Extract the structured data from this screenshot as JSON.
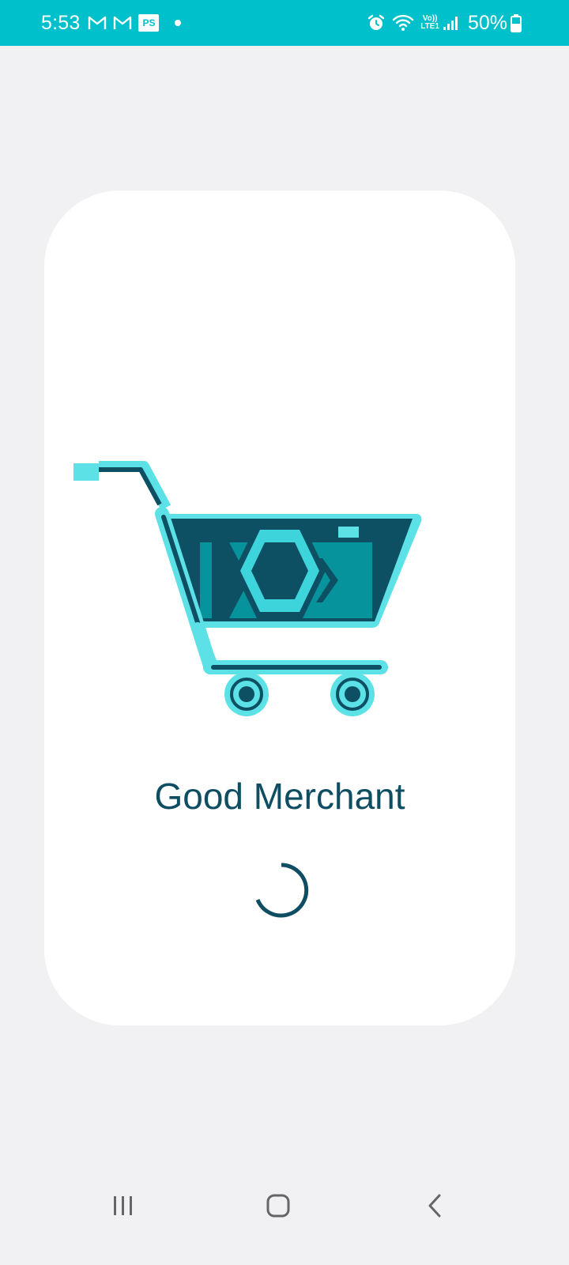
{
  "status_bar": {
    "time": "5:53",
    "left_icons": [
      "gmail-icon",
      "gmail-icon",
      "ps-icon",
      "notification-dot-icon"
    ],
    "ps_label": "PS",
    "right_icons": [
      "alarm-icon",
      "wifi-icon",
      "volte-icon",
      "signal-icon",
      "battery-icon"
    ],
    "volte_top": "Vo))",
    "volte_bottom": "LTE1",
    "battery_percent": "50%",
    "background_color": "#00c0cc"
  },
  "splash": {
    "app_name": "Good Merchant",
    "logo_icon": "shopping-cart-camera-logo-icon",
    "loading_icon": "loading-spinner-icon",
    "text_color": "#0f4d63",
    "accent_color": "#5ce1e6"
  },
  "nav_bar": {
    "buttons": [
      "recent-apps-icon",
      "home-icon",
      "back-icon"
    ]
  }
}
